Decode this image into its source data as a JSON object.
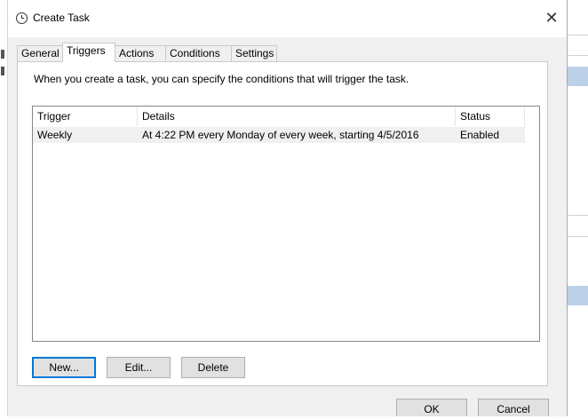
{
  "dialog": {
    "title": "Create Task",
    "close_glyph": "✕",
    "title_icon": "clock-icon"
  },
  "tabs": [
    {
      "label": "General"
    },
    {
      "label": "Triggers",
      "active": true
    },
    {
      "label": "Actions"
    },
    {
      "label": "Conditions"
    },
    {
      "label": "Settings"
    }
  ],
  "triggers_panel": {
    "intro": "When you create a task, you can specify the conditions that will trigger the task.",
    "columns": {
      "trigger": "Trigger",
      "details": "Details",
      "status": "Status"
    },
    "rows": [
      {
        "trigger": "Weekly",
        "details": "At 4:22 PM every Monday of every week, starting 4/5/2016",
        "status": "Enabled"
      }
    ],
    "buttons": {
      "new": "New...",
      "edit": "Edit...",
      "delete": "Delete"
    }
  },
  "footer": {
    "ok": "OK",
    "cancel": "Cancel"
  },
  "colors": {
    "accent_border": "#0078d7",
    "background_selection_stripe": "#bcd0e8"
  }
}
